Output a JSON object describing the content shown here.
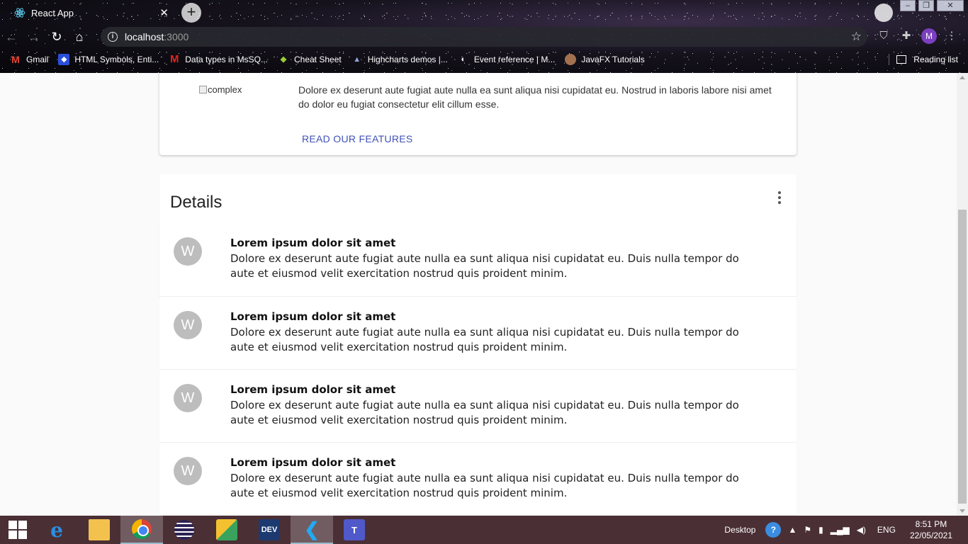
{
  "browser": {
    "tab_title": "React App",
    "tab_close": "✕",
    "new_tab": "+",
    "address_host": "localhost",
    "address_port": ":3000",
    "profile_initial": "M",
    "bookmarks": [
      {
        "label": "Gmail",
        "icon": "gmail-icon",
        "glyph": "M"
      },
      {
        "label": "HTML Symbols, Enti...",
        "icon": "bookmark-icon",
        "glyph": "⬥"
      },
      {
        "label": "Data types in MsSQ...",
        "icon": "bookmark-icon",
        "glyph": "M"
      },
      {
        "label": "Cheat Sheet",
        "icon": "bookmark-icon",
        "glyph": "◆"
      },
      {
        "label": "Highcharts demos |...",
        "icon": "bookmark-icon",
        "glyph": "▲"
      },
      {
        "label": "Event reference | M...",
        "icon": "bookmark-icon",
        "glyph": "◐"
      },
      {
        "label": "JavaFX Tutorials",
        "icon": "bookmark-icon",
        "glyph": ""
      }
    ],
    "reading_list": "Reading list"
  },
  "feature_card": {
    "image_alt": "complex",
    "text": "Dolore ex deserunt aute fugiat aute nulla ea sunt aliqua nisi cupidatat eu. Nostrud in laboris labore nisi amet do dolor eu fugiat consectetur elit cillum esse.",
    "button_label": "READ OUR FEATURES",
    "accent_color": "#3f51b5"
  },
  "details": {
    "title": "Details",
    "items": [
      {
        "avatar": "W",
        "title": "Lorem ipsum dolor sit amet",
        "text": "Dolore ex deserunt aute fugiat aute nulla ea sunt aliqua nisi cupidatat eu. Duis nulla tempor do aute et eiusmod velit exercitation nostrud quis proident minim."
      },
      {
        "avatar": "W",
        "title": "Lorem ipsum dolor sit amet",
        "text": "Dolore ex deserunt aute fugiat aute nulla ea sunt aliqua nisi cupidatat eu. Duis nulla tempor do aute et eiusmod velit exercitation nostrud quis proident minim."
      },
      {
        "avatar": "W",
        "title": "Lorem ipsum dolor sit amet",
        "text": "Dolore ex deserunt aute fugiat aute nulla ea sunt aliqua nisi cupidatat eu. Duis nulla tempor do aute et eiusmod velit exercitation nostrud quis proident minim."
      },
      {
        "avatar": "W",
        "title": "Lorem ipsum dolor sit amet",
        "text": "Dolore ex deserunt aute fugiat aute nulla ea sunt aliqua nisi cupidatat eu. Duis nulla tempor do aute et eiusmod velit exercitation nostrud quis proident minim."
      }
    ]
  },
  "taskbar": {
    "apps": [
      "ie-icon",
      "file-explorer-icon",
      "chrome-icon",
      "eclipse-icon",
      "xml-editor-icon",
      "devcpp-icon",
      "vscode-icon",
      "teams-icon"
    ],
    "desktop_label": "Desktop",
    "language": "ENG",
    "time": "8:51 PM",
    "date": "22/05/2021"
  }
}
